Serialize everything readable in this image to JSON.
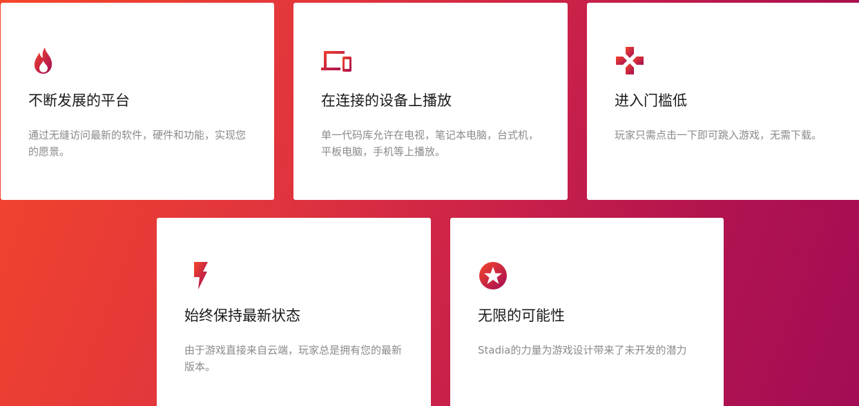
{
  "colors": {
    "gradient_start": "#f4462a",
    "gradient_end": "#a30c55",
    "card_background": "#ffffff",
    "title_text": "#1a1a1a",
    "description_text": "#8a8a8a"
  },
  "features": [
    {
      "icon": "flame-icon",
      "title": "不断发展的平台",
      "description": "通过无缝访问最新的软件，硬件和功能，实现您的愿景。"
    },
    {
      "icon": "devices-icon",
      "title": "在连接的设备上播放",
      "description": "单一代码库允许在电视，笔记本电脑，台式机，平板电脑，手机等上播放。"
    },
    {
      "icon": "gamepad-cross-icon",
      "title": "进入门槛低",
      "description": "玩家只需点击一下即可跳入游戏，无需下载。"
    },
    {
      "icon": "lightning-bolt-icon",
      "title": "始终保持最新状态",
      "description": "由于游戏直接来自云端，玩家总是拥有您的最新版本。"
    },
    {
      "icon": "star-badge-icon",
      "title": "无限的可能性",
      "description": "Stadia的力量为游戏设计带来了未开发的潜力"
    }
  ]
}
